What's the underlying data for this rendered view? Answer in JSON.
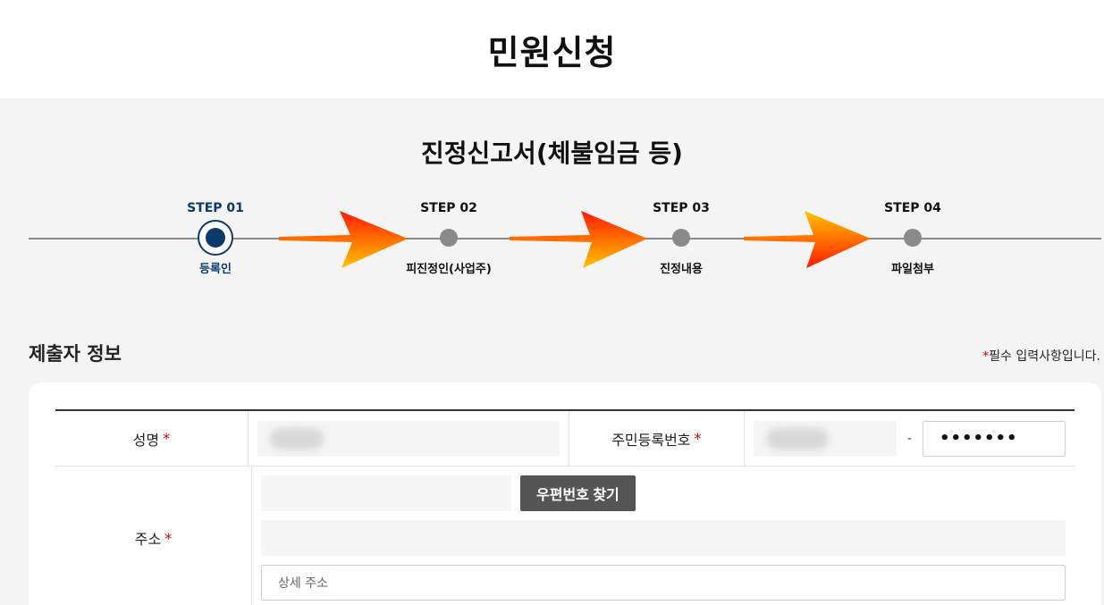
{
  "page": {
    "title": "민원신청"
  },
  "form": {
    "title": "진정신고서(체불임금 등)"
  },
  "steps": [
    {
      "label": "STEP 01",
      "name": "등록인",
      "active": true
    },
    {
      "label": "STEP 02",
      "name": "피진정인(사업주)",
      "active": false
    },
    {
      "label": "STEP 03",
      "name": "진정내용",
      "active": false
    },
    {
      "label": "STEP 04",
      "name": "파일첨부",
      "active": false
    }
  ],
  "section": {
    "title": "제출자 정보",
    "required_star": "*",
    "required_note": "필수 입력사항입니다."
  },
  "fields": {
    "name_label": "성명",
    "rrn_label": "주민등록번호",
    "rrn_dash": "-",
    "rrn_back_masked": "•••••••",
    "address_label": "주소",
    "zip_button": "우편번호 찾기",
    "address_detail_placeholder": "상세 주소",
    "required_mark": "*"
  },
  "colors": {
    "accent": "#0c3a6b",
    "required": "#cc0000",
    "button": "#555555"
  }
}
